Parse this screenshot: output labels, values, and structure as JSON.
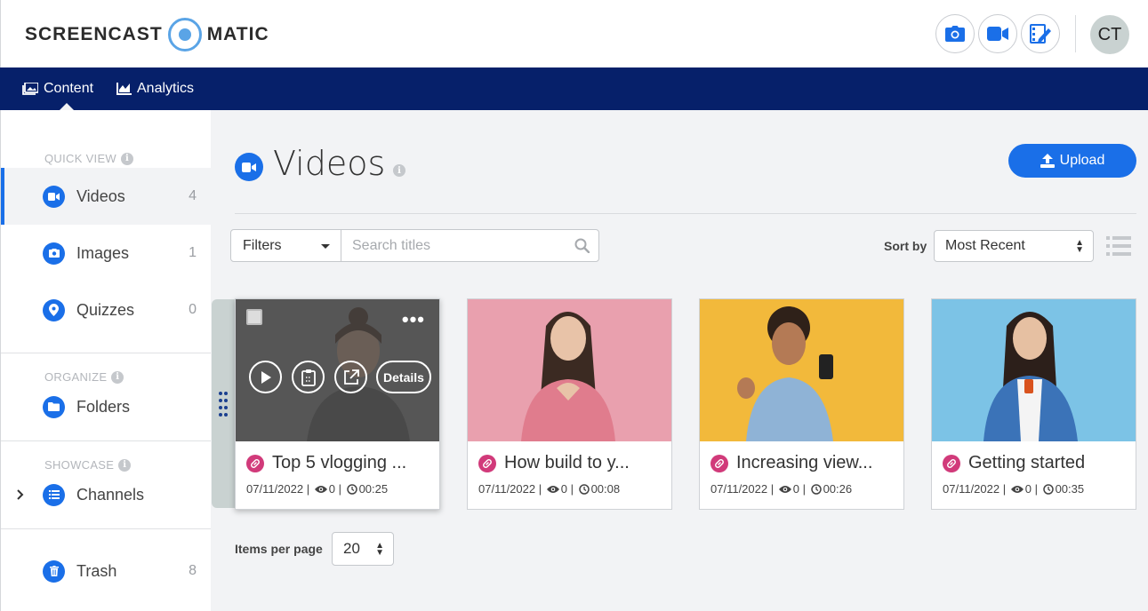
{
  "app": {
    "logo_left": "SCREENCAST",
    "logo_right": "MATIC",
    "avatar_initials": "CT",
    "accent_color": "#1a6fe8",
    "nav_color": "#06206a"
  },
  "header_actions": [
    {
      "name": "camera-icon"
    },
    {
      "name": "video-camera-icon"
    },
    {
      "name": "editor-icon"
    }
  ],
  "nav": {
    "content_label": "Content",
    "analytics_label": "Analytics"
  },
  "sidebar": {
    "quick_view_label": "QUICK VIEW",
    "organize_label": "ORGANIZE",
    "showcase_label": "SHOWCASE",
    "items": [
      {
        "label": "Videos",
        "count": "4",
        "icon": "video-icon"
      },
      {
        "label": "Images",
        "count": "1",
        "icon": "camera-icon"
      },
      {
        "label": "Quizzes",
        "count": "0",
        "icon": "quiz-icon"
      },
      {
        "label": "Folders",
        "icon": "folder-icon"
      },
      {
        "label": "Channels",
        "icon": "list-icon"
      },
      {
        "label": "Trash",
        "count": "8",
        "icon": "trash-icon"
      }
    ]
  },
  "main": {
    "title": "Videos",
    "upload_label": "Upload",
    "filters_label": "Filters",
    "search_placeholder": "Search titles",
    "sort_by_label": "Sort by",
    "sort_value": "Most Recent",
    "items_per_page_label": "Items per page",
    "items_per_page_value": "20",
    "overlay_details_label": "Details"
  },
  "videos": [
    {
      "title": "Top 5 vlogging ...",
      "date": "07/11/2022",
      "views": "0",
      "duration": "00:25",
      "thumb_color": "#9b9b9b"
    },
    {
      "title": "How build to y...",
      "date": "07/11/2022",
      "views": "0",
      "duration": "00:08",
      "thumb_color": "#e9a0ae"
    },
    {
      "title": "Increasing view...",
      "date": "07/11/2022",
      "views": "0",
      "duration": "00:26",
      "thumb_color": "#f2b93b"
    },
    {
      "title": "Getting started",
      "date": "07/11/2022",
      "views": "0",
      "duration": "00:35",
      "thumb_color": "#7cc3e6"
    }
  ]
}
